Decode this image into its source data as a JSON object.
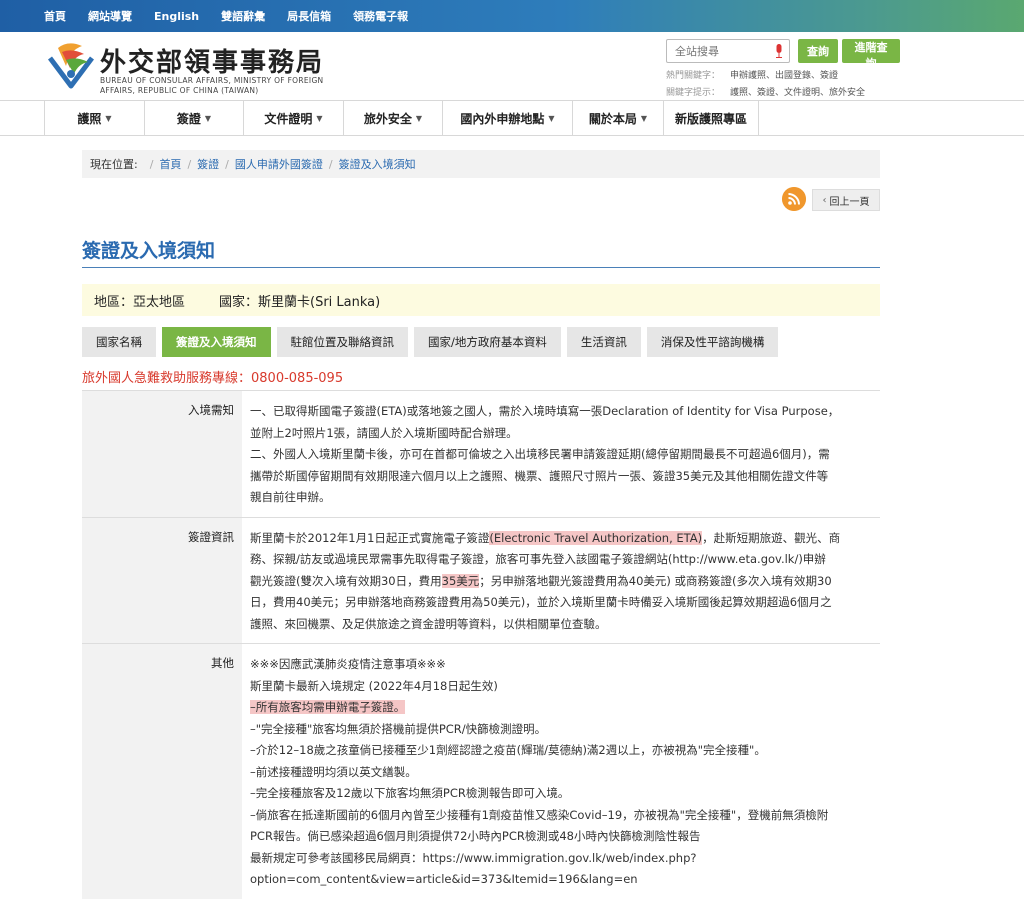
{
  "topbar": {
    "links": [
      "首頁",
      "網站導覽",
      "English",
      "雙語辭彙",
      "局長信箱",
      "領務電子報"
    ]
  },
  "brand": {
    "name_zh": "外交部領事事務局",
    "name_en_line1": "BUREAU OF CONSULAR AFFAIRS, MINISTRY OF FOREIGN",
    "name_en_line2": "AFFAIRS, REPUBLIC OF CHINA (TAIWAN)"
  },
  "search": {
    "placeholder": "全站搜尋",
    "search_label": "查詢",
    "advanced_label": "進階查詢",
    "hot_label": "熱門關鍵字：",
    "hot_keywords": "申辦護照、出國登錄、簽證",
    "hint_label": "關鍵字提示：",
    "hint_keywords": "護照、簽證、文件證明、旅外安全"
  },
  "nav": {
    "items": [
      {
        "label": "護照",
        "caret": "▼"
      },
      {
        "label": "簽證",
        "caret": "▼"
      },
      {
        "label": "文件證明",
        "caret": "▼"
      },
      {
        "label": "旅外安全",
        "caret": "▼"
      },
      {
        "label": "國內外申辦地點",
        "caret": "▼"
      },
      {
        "label": "關於本局",
        "caret": "▼"
      },
      {
        "label": "新版護照專區",
        "caret": ""
      }
    ]
  },
  "breadcrumb": {
    "label": "現在位置:",
    "items": [
      "首頁",
      "簽證",
      "國人申請外國簽證",
      "簽證及入境須知"
    ]
  },
  "toolbar": {
    "back_label": "回上一頁"
  },
  "page": {
    "title": "簽證及入境須知",
    "region": "地區：亞太地區",
    "country": "國家：斯里蘭卡(Sri Lanka)"
  },
  "tabs": [
    {
      "label": "國家名稱",
      "active": false
    },
    {
      "label": "簽證及入境須知",
      "active": true
    },
    {
      "label": "駐館位置及聯絡資訊",
      "active": false
    },
    {
      "label": "國家/地方政府基本資料",
      "active": false
    },
    {
      "label": "生活資訊",
      "active": false
    },
    {
      "label": "消保及性平諮詢機構",
      "active": false
    }
  ],
  "hotline": "旅外國人急難救助服務專線：0800-085-095",
  "table": {
    "entry": {
      "label": "入境需知",
      "lines": [
        "一、已取得斯國電子簽證(ETA)或落地簽之國人，需於入境時填寫一張Declaration of Identity for Visa Purpose，",
        "並附上2吋照片1張，請國人於入境斯國時配合辦理。",
        "二、外國人入境斯里蘭卡後，亦可在首都可倫坡之入出境移民署申請簽證延期(總停留期間最長不可超過6個月)，需",
        "攜帶於斯國停留期間有效期限達六個月以上之護照、機票、護照尺寸照片一張、簽證35美元及其他相關佐證文件等",
        "親自前往申辦。"
      ]
    },
    "visa": {
      "label": "簽證資訊",
      "l1_pre": "斯里蘭卡於2012年1月1日起正式實施電子簽證",
      "l1_hl": "(Electronic Travel Authorization, ETA)",
      "l1_post": "，赴斯短期旅遊、觀光、商",
      "l2": "務、探親/訪友或過境民眾需事先取得電子簽證，旅客可事先登入該國電子簽證網站(http://www.eta.gov.lk/)申辦",
      "l3_pre": "觀光簽證(雙次入境有效期30日，費用",
      "l3_hl": "35美元",
      "l3_post": "；另申辦落地觀光簽證費用為40美元) 或商務簽證(多次入境有效期30",
      "l4": "日，費用40美元；另申辦落地商務簽證費用為50美元)，並於入境斯里蘭卡時備妥入境斯國後起算效期超過6個月之",
      "l5": "護照、來回機票、及足供旅途之資金證明等資料，以供相關單位查驗。"
    },
    "other": {
      "label": "其他",
      "l1": "※※※因應武漢肺炎疫情注意事項※※※",
      "l2": "斯里蘭卡最新入境規定 (2022年4月18日起生效)",
      "l3_hl": "–所有旅客均需申辦電子簽證。",
      "l4": "–\"完全接種\"旅客均無須於搭機前提供PCR/快篩檢測證明。",
      "l5": "–介於12–18歲之孩童倘已接種至少1劑經認證之疫苗(輝瑞/莫德納)滿2週以上，亦被視為\"完全接種\"。",
      "l6": "–前述接種證明均須以英文繕製。",
      "l7": "–完全接種旅客及12歲以下旅客均無須PCR檢測報告即可入境。",
      "l8": "–倘旅客在抵達斯國前的6個月內曾至少接種有1劑疫苗惟又感染Covid–19，亦被視為\"完全接種\"，登機前無須檢附",
      "l9": "PCR報告。倘已感染超過6個月則須提供72小時內PCR檢測或48小時內快篩檢測陰性報告",
      "l10": "最新規定可參考該國移民局網頁：https://www.immigration.gov.lk/web/index.php?",
      "l11": "option=com_content&view=article&id=373&Itemid=196&lang=en"
    }
  }
}
